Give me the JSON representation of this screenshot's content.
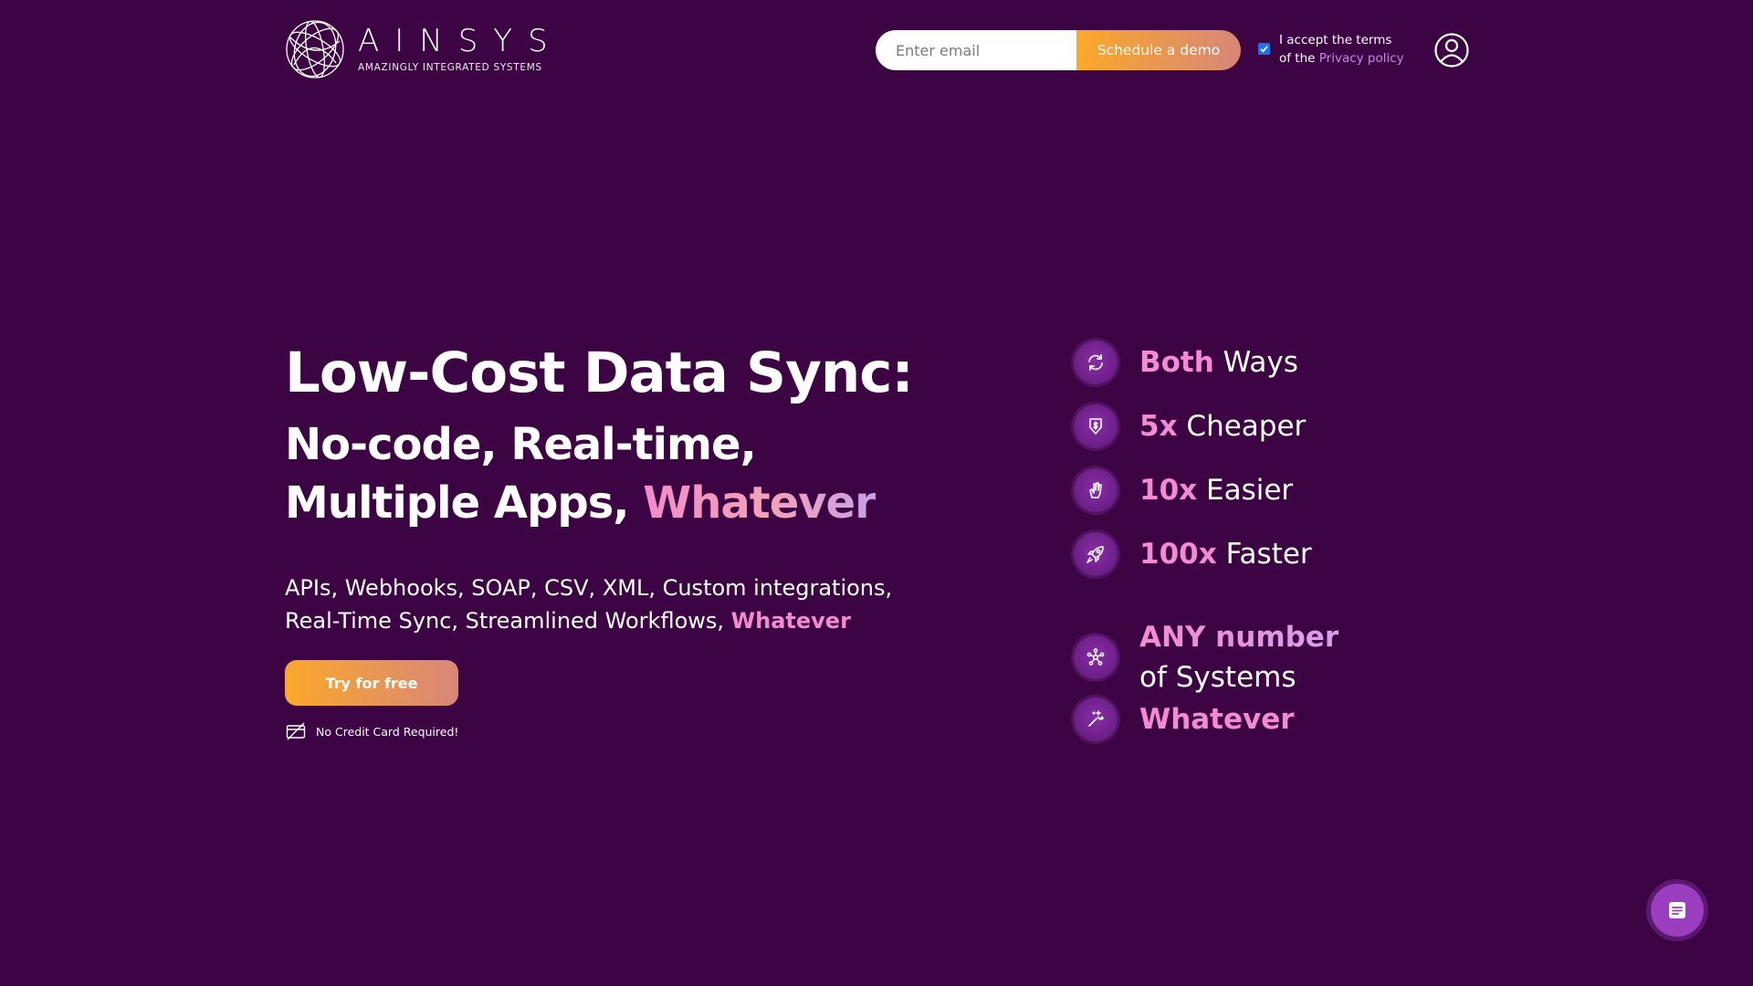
{
  "brand": {
    "name": "AINSYS",
    "tagline": "AMAZINGLY INTEGRATED SYSTEMS",
    "logo_icon": "globe-logo-icon"
  },
  "header": {
    "email_placeholder": "Enter email",
    "email_value": "",
    "demo_button": "Schedule a demo",
    "terms_checked": true,
    "terms_line1": "I accept the terms",
    "terms_line2_prefix": "of the ",
    "terms_link": "Privacy policy",
    "account_icon": "user-circle-icon"
  },
  "hero": {
    "title": "Low-Cost Data Sync:",
    "subtitle_line1": "No-code, Real-time,",
    "subtitle_line2_prefix": "Multiple Apps, ",
    "subtitle_line2_highlight": "Whatever",
    "description_line1": "APIs, Webhooks, SOAP, CSV, XML, Custom integrations,",
    "description_line2_prefix": "Real-Time Sync, Streamlined Workflows, ",
    "description_line2_highlight": "Whatever",
    "cta_button": "Try for free",
    "no_card_text": "No Credit Card Required!",
    "no_card_icon": "no-credit-card-icon"
  },
  "features": [
    {
      "icon": "sync-arrows-icon",
      "accent": "Both",
      "text": " Ways"
    },
    {
      "icon": "price-down-icon",
      "accent": "5x",
      "text": " Cheaper"
    },
    {
      "icon": "hand-gesture-icon",
      "accent": "10x",
      "text": " Easier"
    },
    {
      "icon": "rocket-icon",
      "accent": "100x",
      "text": " Faster"
    },
    {
      "icon": "network-nodes-icon",
      "accent": "ANY number",
      "text": "of Systems"
    },
    {
      "icon": "magic-wand-icon",
      "accent": "Whatever",
      "text": ""
    }
  ],
  "chat": {
    "icon": "chat-message-icon"
  },
  "colors": {
    "background": "#3c0443",
    "accent_pink": "#f48ad3",
    "cta_orange": "#fba82a",
    "cta_salmon": "#d78679",
    "link_purple": "#c884e6",
    "icon_circle": "#7a259a"
  }
}
